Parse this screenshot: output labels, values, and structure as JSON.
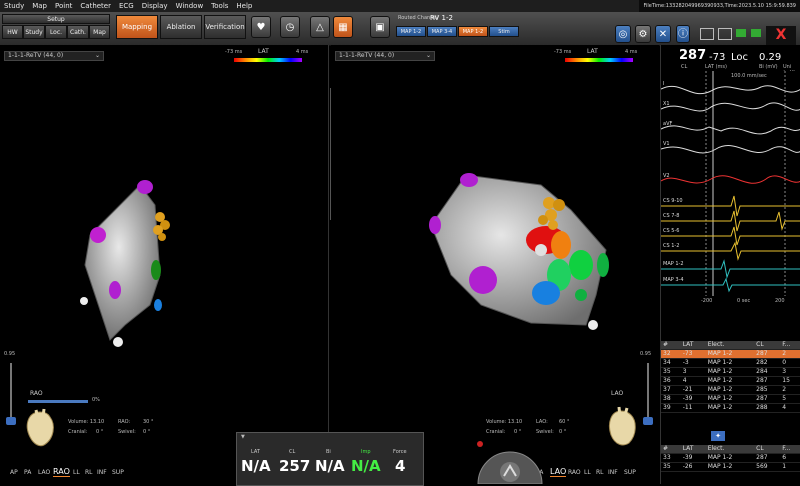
{
  "menu": [
    "Study",
    "Map",
    "Point",
    "Catheter",
    "ECG",
    "Display",
    "Window",
    "Tools",
    "Help"
  ],
  "filetime": "FileTime:133282049969390933,Time:2023.5.10 15:9:59.839",
  "toolbar": {
    "setup": "Setup",
    "tabs": [
      "HW",
      "Study",
      "Loc.",
      "Cath.",
      "Map"
    ],
    "mapping": "Mapping",
    "ablation": "Ablation",
    "verification": "Verification",
    "routed_label": "Routed Channel",
    "routed_value": "RV 1-2",
    "channels": [
      "MAP 1-2",
      "MAP 3-4",
      "MAP 1-2",
      "Stim"
    ],
    "corner_number": "1281"
  },
  "left_view": {
    "map_select": "1-1-1-ReTV (44, 0)",
    "lat_min": "-73 ms",
    "lat_label": "LAT",
    "lat_max": "4 ms",
    "scale_value": "0.95",
    "orientation": "RAO",
    "volume": "Volume: 13.10",
    "rao_angle_label": "RAO:",
    "rao_angle": "30 °",
    "cranial_label": "Cranial:",
    "cranial": "0 °",
    "swivel_label": "Swivel:",
    "swivel": "0 °",
    "slider_value": "0%",
    "views": [
      "AP",
      "PA",
      "LAO",
      "RAO",
      "LL",
      "RL",
      "INF",
      "SUP"
    ]
  },
  "right_view": {
    "map_select": "1-1-1-ReTV (44, 0)",
    "lat_min": "-73 ms",
    "lat_label": "LAT",
    "lat_max": "4 ms",
    "scale_value": "0.95",
    "orientation": "LAO",
    "volume": "Volume: 13.10",
    "lao_angle_label": "LAO:",
    "lao_angle": "60 °",
    "cranial_label": "Cranial:",
    "cranial": "0 °",
    "swivel_label": "Swivel:",
    "swivel": "0 °",
    "views": [
      "AP",
      "PA",
      "LAO",
      "RAO",
      "LL",
      "RL",
      "INF",
      "SUP"
    ]
  },
  "center_tool": {
    "force_value": "4",
    "force_unit": "g"
  },
  "bottom_readout": {
    "labels": [
      "LAT",
      "CL",
      "Bi",
      "Imp",
      "Force"
    ],
    "values": [
      "N/A",
      "257",
      "N/A",
      "N/A",
      "4"
    ]
  },
  "header_stats": {
    "cl": "287",
    "cl_label": "CL",
    "lat": "-73",
    "lat_label": "LAT (ms)",
    "loc": "Loc",
    "bi": "0.29",
    "bi_label": "Bi (mV)",
    "uni_label": "Uni (mV)",
    "speed": "100.0 mm/sec",
    "time_label": "0 sec",
    "tick_left": "-200",
    "tick_right": "200"
  },
  "waves": [
    "I",
    "X1",
    "aVF",
    "V1",
    "V2",
    "CS 9-10",
    "CS 7-8",
    "CS 5-6",
    "CS 1-2",
    "MAP 1-2",
    "MAP 3-4"
  ],
  "lat_table_top": {
    "headers": [
      "#",
      "LAT",
      "Elect.",
      "CL",
      "F..."
    ],
    "rows": [
      [
        "32",
        "-73",
        "MAP 1-2",
        "287",
        "2"
      ],
      [
        "34",
        "-3",
        "MAP 1-2",
        "282",
        "0"
      ],
      [
        "35",
        "3",
        "MAP 1-2",
        "284",
        "3"
      ],
      [
        "36",
        "4",
        "MAP 1-2",
        "287",
        "15"
      ],
      [
        "37",
        "-21",
        "MAP 1-2",
        "285",
        "2"
      ],
      [
        "38",
        "-39",
        "MAP 1-2",
        "287",
        "5"
      ],
      [
        "39",
        "-11",
        "MAP 1-2",
        "288",
        "4"
      ]
    ]
  },
  "lat_table_bottom": {
    "headers": [
      "#",
      "LAT",
      "Elect.",
      "CL",
      "F..."
    ],
    "rows": [
      [
        "33",
        "-39",
        "MAP 1-2",
        "287",
        "6"
      ],
      [
        "35",
        "-26",
        "MAP 1-2",
        "569",
        "1"
      ]
    ]
  }
}
